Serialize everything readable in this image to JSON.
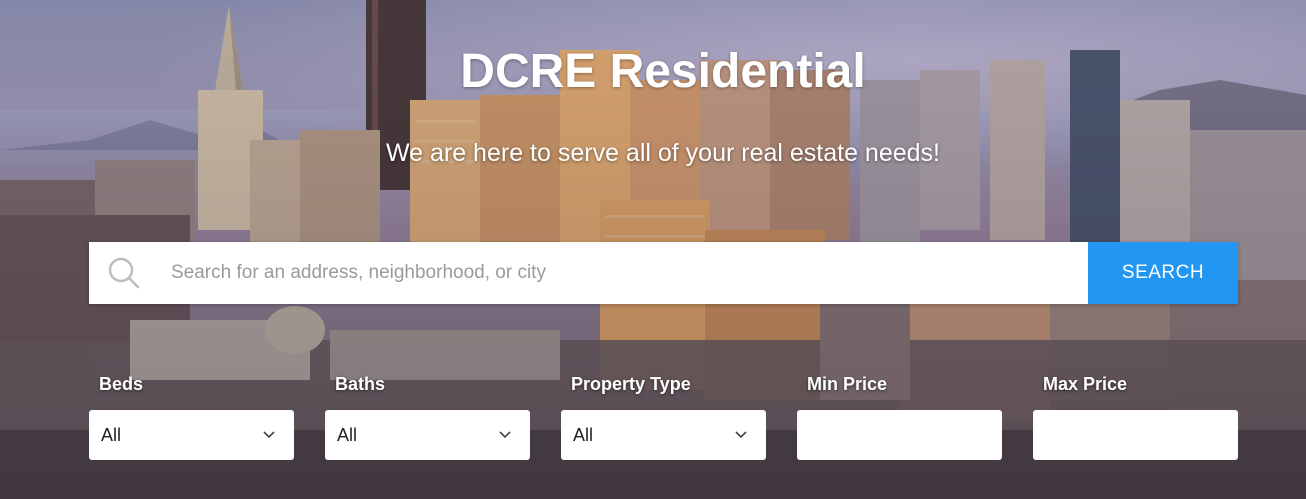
{
  "hero": {
    "title": "DCRE Residential",
    "subtitle": "We are here to serve all of your real estate needs!"
  },
  "search": {
    "placeholder": "Search for an address, neighborhood, or city",
    "value": "",
    "button_label": "SEARCH",
    "icon": "search-icon"
  },
  "filters": {
    "beds": {
      "label": "Beds",
      "value": "All",
      "icon": "chevron-down-icon"
    },
    "baths": {
      "label": "Baths",
      "value": "All",
      "icon": "chevron-down-icon"
    },
    "property_type": {
      "label": "Property Type",
      "value": "All",
      "icon": "chevron-down-icon"
    },
    "min_price": {
      "label": "Min Price",
      "value": ""
    },
    "max_price": {
      "label": "Max Price",
      "value": ""
    }
  },
  "colors": {
    "accent": "#2196f3",
    "text_light": "#ffffff",
    "placeholder": "#9a9a9a"
  }
}
